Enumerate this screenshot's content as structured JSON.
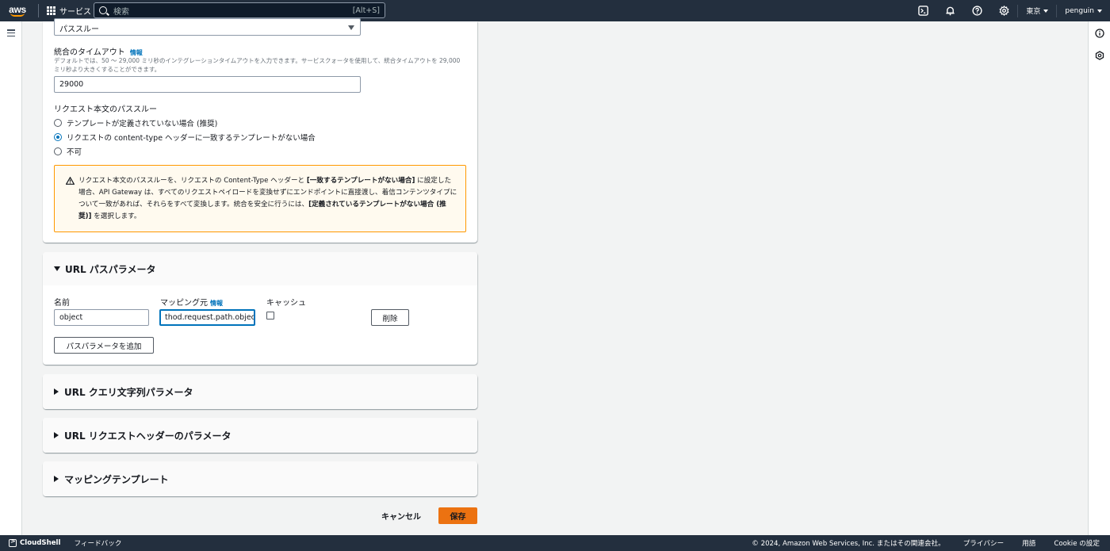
{
  "topnav": {
    "logo": "aws",
    "services_label": "サービス",
    "search_placeholder": "検索",
    "search_shortcut": "[Alt+S]",
    "region_label": "東京",
    "user_label": "penguin"
  },
  "integration": {
    "select_value": "パススルー",
    "timeout_label": "統合のタイムアウト",
    "timeout_info": "情報",
    "timeout_desc": "デフォルトでは、50 〜 29,000 ミリ秒のインテグレーションタイムアウトを入力できます。サービスクォータを使用して、統合タイムアウトを 29,000 ミリ秒より大きくすることができます。",
    "timeout_value": "29000",
    "passthrough_label": "リクエスト本文のパススルー",
    "radio_options": [
      {
        "label": "テンプレートが定義されていない場合 (推奨)",
        "checked": false
      },
      {
        "label": "リクエストの content-type ヘッダーに一致するテンプレートがない場合",
        "checked": true
      },
      {
        "label": "不可",
        "checked": false
      }
    ],
    "warning": {
      "part1": "リクエスト本文のパススルーを、リクエストの Content-Type ヘッダーと ",
      "bold1": "[一致するテンプレートがない場合]",
      "part2": " に設定した場合、API Gateway は、すべてのリクエストペイロードを変換せずにエンドポイントに直接渡し、着信コンテンツタイプについて一致があれば、それらをすべて変換します。統合を安全に行うには、",
      "bold2": "[定義されているテンプレートがない場合 (推奨)]",
      "part3": " を選択します。"
    }
  },
  "path_params": {
    "title": "URL パスパラメータ",
    "name_label": "名前",
    "mapping_label": "マッピング元",
    "mapping_info": "情報",
    "cache_label": "キャッシュ",
    "name_value": "object",
    "mapping_value": "thod.request.path.object",
    "cache_checked": false,
    "delete_label": "削除",
    "add_label": "パスパラメータを追加"
  },
  "sections": {
    "query_title": "URL クエリ文字列パラメータ",
    "headers_title": "URL リクエストヘッダーのパラメータ",
    "mapping_title": "マッピングテンプレート"
  },
  "actions": {
    "cancel_label": "キャンセル",
    "save_label": "保存"
  },
  "footer": {
    "cloudshell_label": "CloudShell",
    "feedback_label": "フィードバック",
    "copyright": "© 2024, Amazon Web Services, Inc. またはその関連会社。",
    "privacy": "プライバシー",
    "terms": "用語",
    "cookie": "Cookie の設定"
  },
  "colors": {
    "nav_bg": "#232f3e",
    "primary_button": "#ec7211",
    "link": "#0073bb",
    "warning_border": "#ff9900",
    "warning_bg": "#fffaef"
  }
}
